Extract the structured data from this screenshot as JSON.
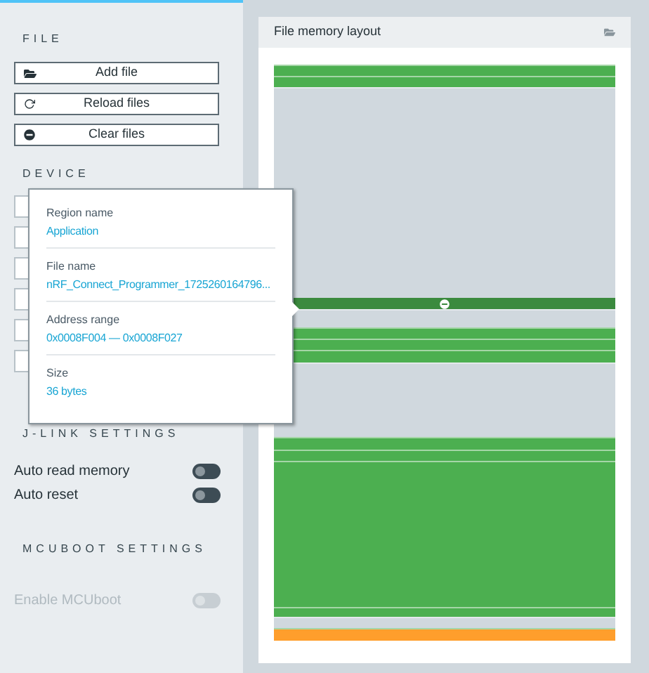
{
  "sidebar": {
    "file_section": {
      "heading": "FILE",
      "buttons": [
        {
          "label": "Add file"
        },
        {
          "label": "Reload files"
        },
        {
          "label": "Clear files"
        }
      ]
    },
    "device_section": {
      "heading": "DEVICE"
    },
    "jlink_section": {
      "heading": "J-LINK SETTINGS",
      "toggles": [
        {
          "label": "Auto read memory",
          "on": false,
          "disabled": false
        },
        {
          "label": "Auto reset",
          "on": false,
          "disabled": false
        }
      ]
    },
    "mcuboot_section": {
      "heading": "MCUBOOT SETTINGS",
      "toggles": [
        {
          "label": "Enable MCUboot",
          "on": false,
          "disabled": true
        }
      ]
    }
  },
  "memory_panel": {
    "title": "File memory layout",
    "regions": [
      {
        "kind": "used",
        "color": "#4caf50",
        "selected": false
      },
      {
        "kind": "used",
        "color": "#4caf50",
        "selected": false
      },
      {
        "kind": "free"
      },
      {
        "kind": "used",
        "color": "#3b8a3e",
        "selected": true
      },
      {
        "kind": "free"
      },
      {
        "kind": "used",
        "color": "#4caf50",
        "selected": false
      },
      {
        "kind": "used",
        "color": "#4caf50",
        "selected": false
      },
      {
        "kind": "used",
        "color": "#4caf50",
        "selected": false
      },
      {
        "kind": "free"
      },
      {
        "kind": "used",
        "color": "#4caf50",
        "selected": false
      },
      {
        "kind": "used",
        "color": "#4caf50",
        "selected": false
      },
      {
        "kind": "used",
        "color": "#4caf50",
        "selected": false
      },
      {
        "kind": "used",
        "color": "#4caf50",
        "selected": false
      },
      {
        "kind": "free"
      },
      {
        "kind": "used",
        "color": "#ff9e2c",
        "selected": false
      }
    ]
  },
  "tooltip": {
    "fields": [
      {
        "label": "Region name",
        "value": "Application"
      },
      {
        "label": "File name",
        "value": "nRF_Connect_Programmer_1725260164796..."
      },
      {
        "label": "Address range",
        "value": "0x0008F004 — 0x0008F027"
      },
      {
        "label": "Size",
        "value": "36 bytes"
      }
    ]
  }
}
